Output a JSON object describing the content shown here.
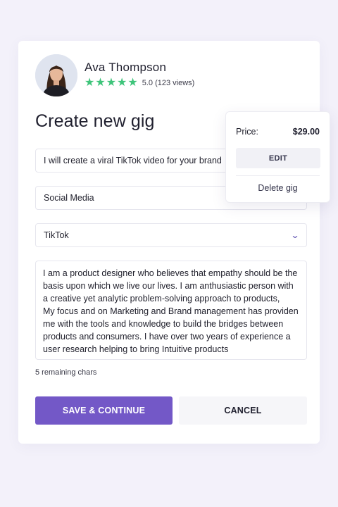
{
  "profile": {
    "name": "Ava Thompson",
    "rating_stars": 5,
    "rating_text": "5.0 (123 views)"
  },
  "page": {
    "title": "Create new gig"
  },
  "form": {
    "gig_title": "I will create a viral TikTok video for your brand",
    "category": "Social Media",
    "platform": "TikTok",
    "description": "I am a product designer who believes that empathy should be the\nbasis upon which we live our lives. I am anthusiastic person with\na creative yet analytic problem-solving approach to products,\nMy focus and on Marketing and Brand management has providen\nme with the tools and knowledge to build the bridges between\nproducts and consumers. I have over two years of experience a\nuser research helping to bring Intuitive products",
    "remaining": "5 remaining chars"
  },
  "buttons": {
    "save": "SAVE & CONTINUE",
    "cancel": "CANCEL"
  },
  "price_popover": {
    "label": "Price:",
    "price": "$29.00",
    "edit": "EDIT",
    "delete": "Delete gig"
  },
  "icons": {
    "star": "star-icon",
    "chevron": "chevron-down-icon"
  },
  "colors": {
    "accent": "#7358c7",
    "star": "#3ec47a",
    "background": "#f3f1fa"
  }
}
